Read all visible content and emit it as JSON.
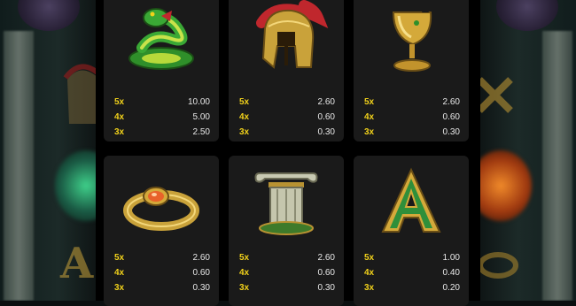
{
  "paytable": {
    "symbols": [
      {
        "icon": "snake-icon",
        "payouts": [
          {
            "mult": "5x",
            "value": "10.00"
          },
          {
            "mult": "4x",
            "value": "5.00"
          },
          {
            "mult": "3x",
            "value": "2.50"
          }
        ]
      },
      {
        "icon": "spartan-helmet-icon",
        "payouts": [
          {
            "mult": "5x",
            "value": "2.60"
          },
          {
            "mult": "4x",
            "value": "0.60"
          },
          {
            "mult": "3x",
            "value": "0.30"
          }
        ]
      },
      {
        "icon": "golden-chalice-icon",
        "payouts": [
          {
            "mult": "5x",
            "value": "2.60"
          },
          {
            "mult": "4x",
            "value": "0.60"
          },
          {
            "mult": "3x",
            "value": "0.30"
          }
        ]
      },
      {
        "icon": "ruby-ring-icon",
        "payouts": [
          {
            "mult": "5x",
            "value": "2.60"
          },
          {
            "mult": "4x",
            "value": "0.60"
          },
          {
            "mult": "3x",
            "value": "0.30"
          }
        ]
      },
      {
        "icon": "greek-column-icon",
        "payouts": [
          {
            "mult": "5x",
            "value": "2.60"
          },
          {
            "mult": "4x",
            "value": "0.60"
          },
          {
            "mult": "3x",
            "value": "0.30"
          }
        ]
      },
      {
        "icon": "letter-a-icon",
        "payouts": [
          {
            "mult": "5x",
            "value": "1.00"
          },
          {
            "mult": "4x",
            "value": "0.40"
          },
          {
            "mult": "3x",
            "value": "0.20"
          }
        ]
      }
    ]
  },
  "colors": {
    "multiplier": "#f2d21a",
    "value": "#e8e8e8",
    "card": "#1a1a1a",
    "panel": "#000000"
  },
  "glyphs": {
    "card_a": "A",
    "bg_a": "A"
  }
}
